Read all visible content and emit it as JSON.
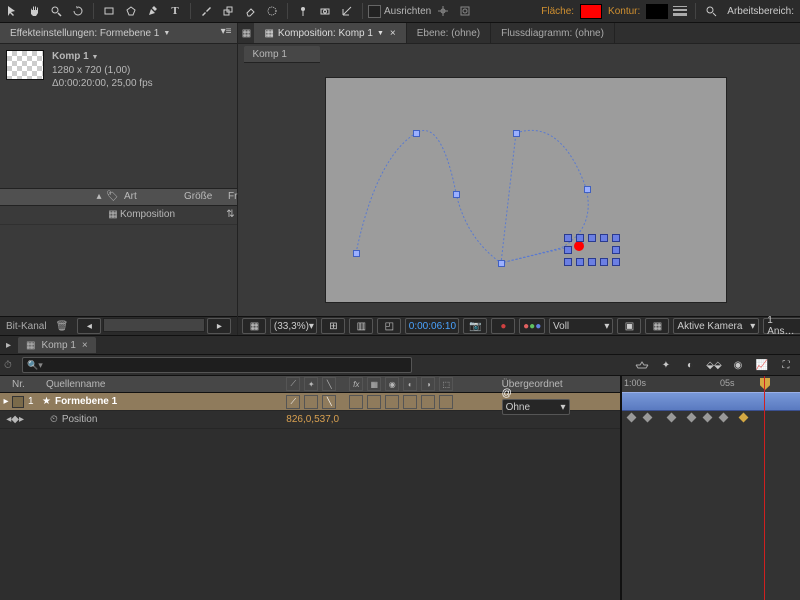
{
  "toolbar": {
    "icons": [
      "arrow",
      "hand",
      "zoom",
      "rotate",
      "square",
      "pentagon",
      "pen",
      "text",
      "brush",
      "stamp",
      "eraser",
      "roto",
      "pin",
      "camera",
      "axis"
    ],
    "align": "Ausrichten",
    "fill_label": "Fläche:",
    "fill_color": "#ff0000",
    "stroke_label": "Kontur:",
    "stroke_color": "#000000",
    "workspace_label": "Arbeitsbereich:"
  },
  "effect_panel": {
    "title": "Effekteinstellungen: Formebene 1",
    "comp_name": "Komp 1",
    "dimensions": "1280 x 720 (1,00)",
    "duration": "Δ0:00:20:00, 25,00 fps",
    "columns": {
      "type": "Art",
      "size": "Größe",
      "fr": "Fr"
    },
    "row_type": "Komposition",
    "status": "Bit-Kanal"
  },
  "viewer": {
    "tabs": [
      {
        "label": "Komposition: Komp 1",
        "active": true
      },
      {
        "label": "Ebene: (ohne)",
        "active": false
      },
      {
        "label": "Flussdiagramm: (ohne)",
        "active": false
      }
    ],
    "subtab": "Komp 1",
    "status": {
      "zoom": "(33,3%)",
      "timecode": "0:00:06:10",
      "resolution": "Voll",
      "camera": "Aktive Kamera",
      "views": "1 Ans…"
    }
  },
  "timeline": {
    "tab": "Komp 1",
    "search_placeholder": "",
    "header": {
      "num": "Nr.",
      "name": "Quellenname",
      "parent": "Übergeordnet"
    },
    "ruler": {
      "start": "1:00s",
      "mid": "05s"
    },
    "layers": [
      {
        "num": "1",
        "name": "Formebene 1",
        "parent": "Ohne",
        "selected": true,
        "properties": [
          {
            "name": "Position",
            "value": "826,0,537,0"
          }
        ]
      }
    ]
  }
}
